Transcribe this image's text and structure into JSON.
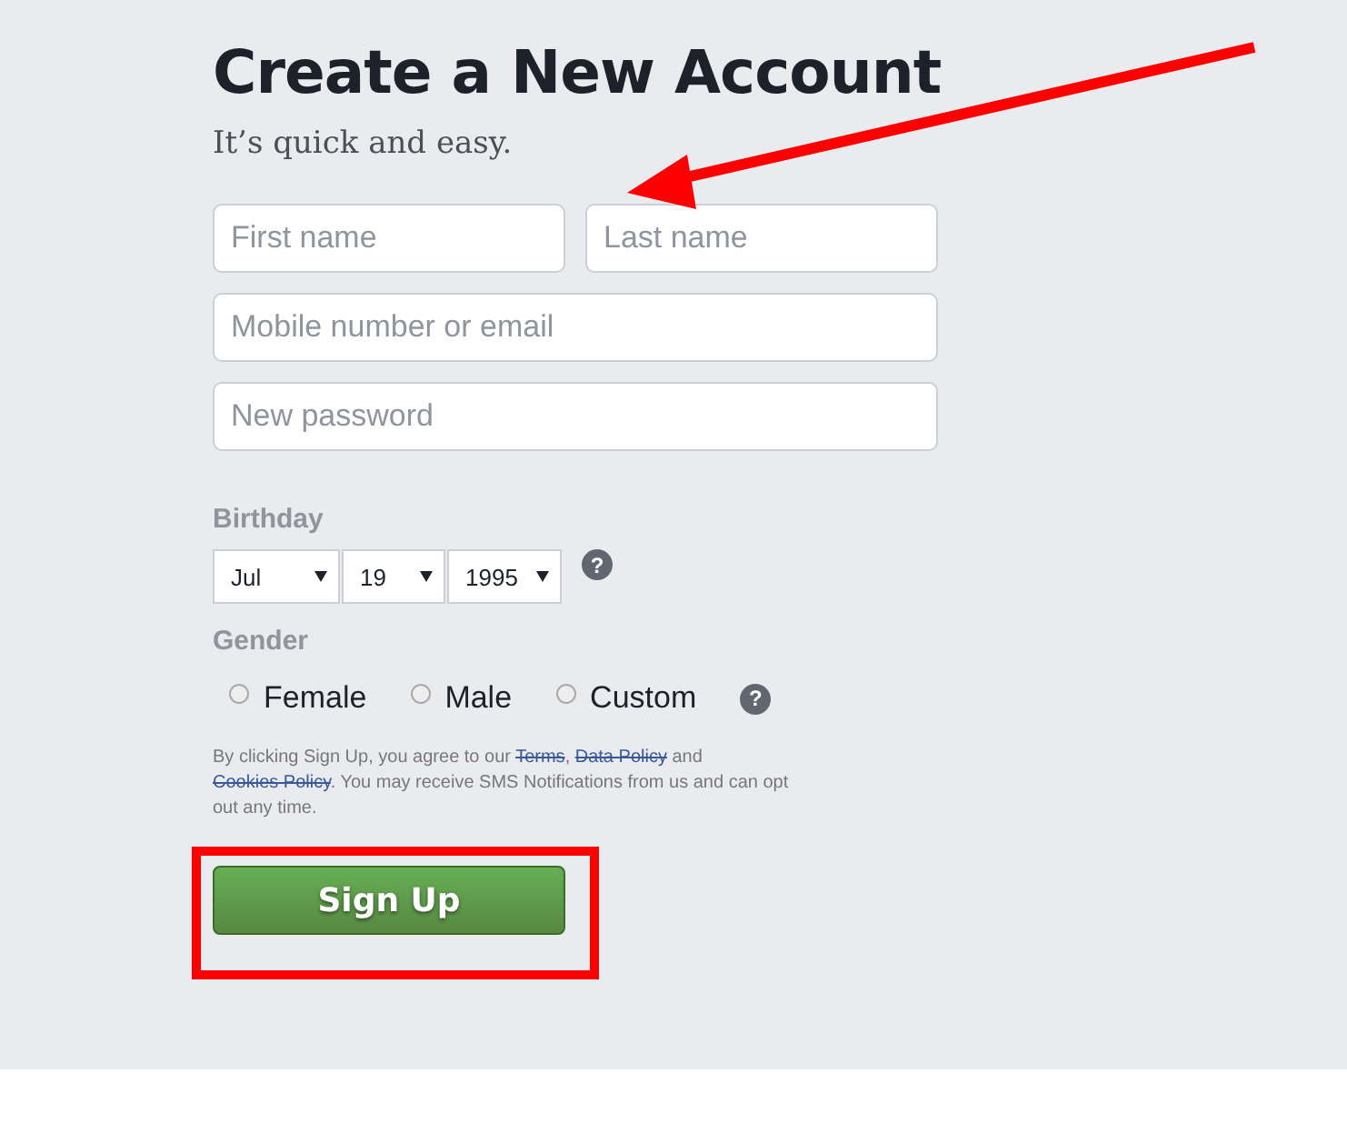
{
  "title": "Create a New Account",
  "subtitle": "It’s quick and easy.",
  "fields": [
    {
      "placeholder": "First name"
    },
    {
      "placeholder": "Last name"
    },
    {
      "placeholder": "Mobile number or email"
    },
    {
      "placeholder": "New password"
    }
  ],
  "birthday": {
    "label": "Birthday",
    "selects": [
      {
        "value": "Jul"
      },
      {
        "value": "19"
      },
      {
        "value": "1995"
      }
    ],
    "help": "?"
  },
  "gender": {
    "label": "Gender",
    "options": [
      {
        "label": "Female",
        "selected": false
      },
      {
        "label": "Male",
        "selected": false
      },
      {
        "label": "Custom",
        "selected": false
      }
    ],
    "help": "?"
  },
  "terms": [
    {
      "kind": "text",
      "text": "By clicking Sign Up, you agree to our "
    },
    {
      "kind": "link",
      "text": "Terms"
    },
    {
      "kind": "text",
      "text": ", "
    },
    {
      "kind": "link",
      "text": "Data Policy"
    },
    {
      "kind": "text",
      "text": " and "
    },
    {
      "kind": "link",
      "text": "Cookies Policy"
    },
    {
      "kind": "text",
      "text": ". You may receive SMS Notifications from us and can opt out any time."
    }
  ],
  "button": "Sign Up",
  "arrow": {
    "color": "#ff0000"
  },
  "highlight_box": {
    "color": "#ff0000"
  }
}
